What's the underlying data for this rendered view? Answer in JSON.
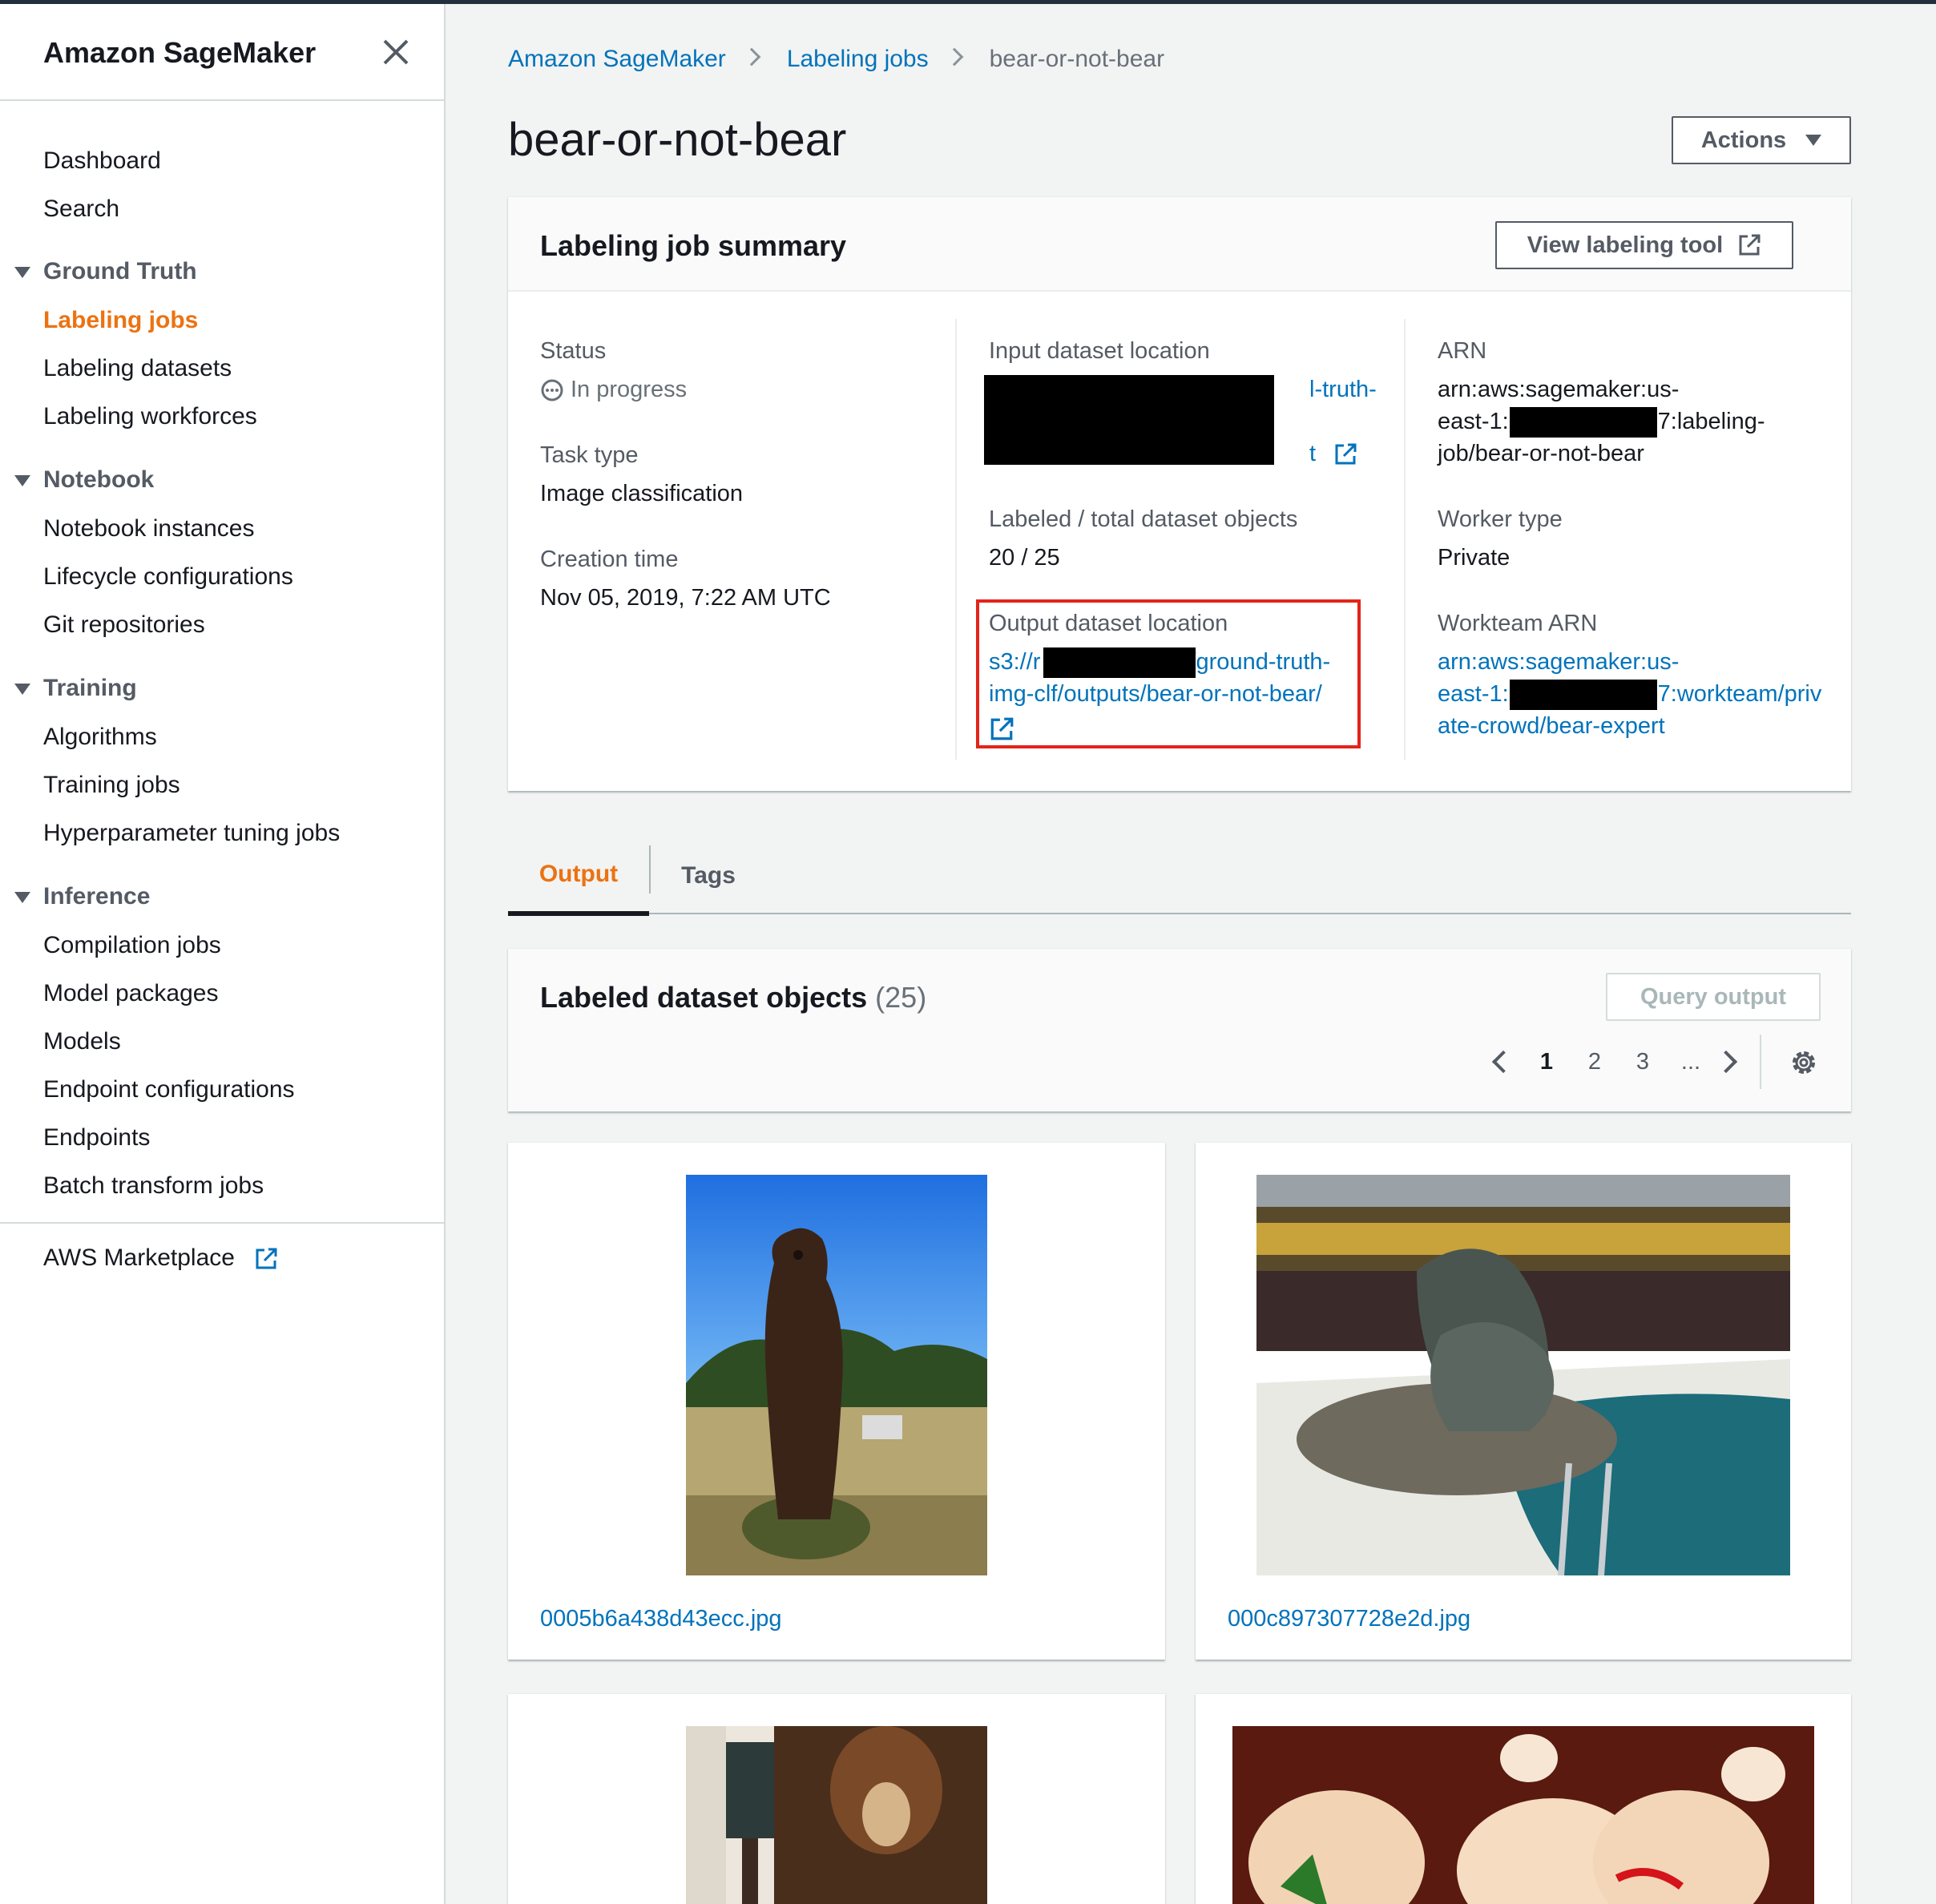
{
  "sidebar": {
    "title": "Amazon SageMaker",
    "items": {
      "dashboard": "Dashboard",
      "search": "Search",
      "ground_truth": "Ground Truth",
      "labeling_jobs": "Labeling jobs",
      "labeling_datasets": "Labeling datasets",
      "labeling_workforces": "Labeling workforces",
      "notebook": "Notebook",
      "notebook_instances": "Notebook instances",
      "lifecycle_configurations": "Lifecycle configurations",
      "git_repositories": "Git repositories",
      "training": "Training",
      "algorithms": "Algorithms",
      "training_jobs": "Training jobs",
      "hyperparameter_tuning_jobs": "Hyperparameter tuning jobs",
      "inference": "Inference",
      "compilation_jobs": "Compilation jobs",
      "model_packages": "Model packages",
      "models": "Models",
      "endpoint_configurations": "Endpoint configurations",
      "endpoints": "Endpoints",
      "batch_transform_jobs": "Batch transform jobs",
      "aws_marketplace": "AWS Marketplace"
    }
  },
  "breadcrumb": {
    "root": "Amazon SageMaker",
    "parent": "Labeling jobs",
    "current": "bear-or-not-bear"
  },
  "page": {
    "title": "bear-or-not-bear",
    "actions_label": "Actions"
  },
  "summary": {
    "title": "Labeling job summary",
    "view_tool_label": "View labeling tool",
    "status_label": "Status",
    "status_value": "In progress",
    "task_type_label": "Task type",
    "task_type_value": "Image classification",
    "creation_time_label": "Creation time",
    "creation_time_value": "Nov 05, 2019, 7:22 AM UTC",
    "input_location_label": "Input dataset location",
    "input_location_line1": "l-truth-",
    "input_location_line2": "t",
    "labeled_total_label": "Labeled / total dataset objects",
    "labeled_total_value": "20 / 25",
    "output_location_label": "Output dataset location",
    "output_location_line1a": "s3://r",
    "output_location_line1b": "/ground-truth-",
    "output_location_line2": "img-clf/outputs/bear-or-not-bear/",
    "arn_label": "ARN",
    "arn_line1": "arn:aws:sagemaker:us-",
    "arn_line2a": "east-1:",
    "arn_line2b": "7:labeling-",
    "arn_line3": "job/bear-or-not-bear",
    "worker_type_label": "Worker type",
    "worker_type_value": "Private",
    "workteam_arn_label": "Workteam ARN",
    "workteam_line1": "arn:aws:sagemaker:us-",
    "workteam_line2a": "east-1:",
    "workteam_line2b": "7:workteam/priv",
    "workteam_line3": "ate-crowd/bear-expert"
  },
  "tabs": {
    "output": "Output",
    "tags": "Tags"
  },
  "objects": {
    "title": "Labeled dataset objects",
    "count": "(25)",
    "query_label": "Query output",
    "pages": [
      "1",
      "2",
      "3",
      "..."
    ],
    "images": [
      {
        "filename": "0005b6a438d43ecc.jpg"
      },
      {
        "filename": "000c897307728e2d.jpg"
      }
    ]
  },
  "colors": {
    "accent": "#ec7211",
    "link": "#0073bb",
    "highlight": "#e3241b"
  }
}
